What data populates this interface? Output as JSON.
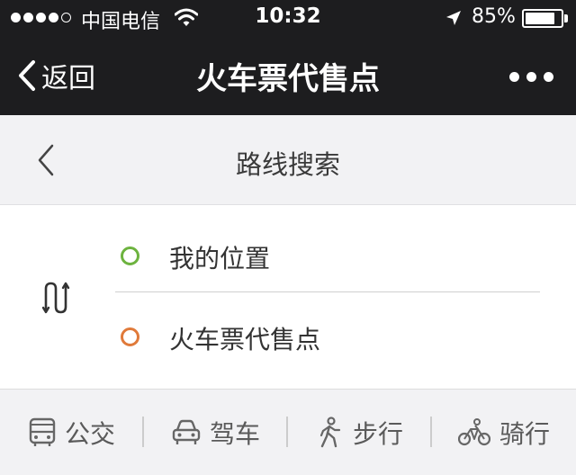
{
  "status_bar": {
    "carrier": "中国电信",
    "time": "10:32",
    "battery_percent": "85%",
    "battery_level": 0.85
  },
  "nav": {
    "back_label": "返回",
    "title": "火车票代售点"
  },
  "route": {
    "title": "路线搜索",
    "from": "我的位置",
    "to": "火车票代售点"
  },
  "modes": [
    {
      "label": "公交",
      "icon": "bus-icon"
    },
    {
      "label": "驾车",
      "icon": "car-icon"
    },
    {
      "label": "步行",
      "icon": "walk-icon"
    },
    {
      "label": "骑行",
      "icon": "bicycle-icon"
    }
  ],
  "colors": {
    "nav_bg": "#1d1d1f",
    "origin_ring": "#6db33f",
    "destination_ring": "#e07a3a",
    "panel_bg": "#f2f2f4"
  }
}
